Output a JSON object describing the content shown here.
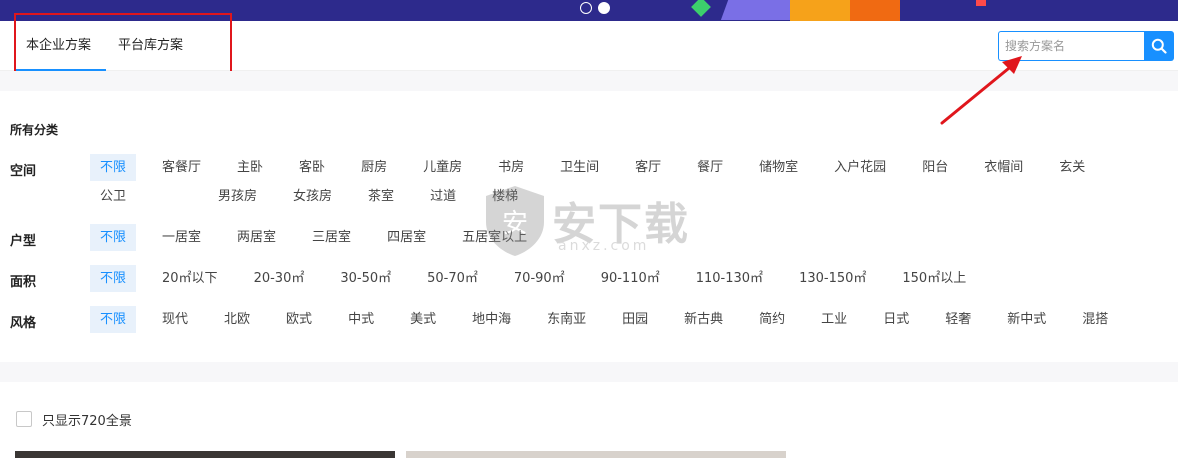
{
  "tabs": [
    {
      "label": "本企业方案",
      "active": true
    },
    {
      "label": "平台库方案",
      "active": false
    }
  ],
  "search": {
    "placeholder": "搜索方案名"
  },
  "filters": {
    "all_label": "所有分类",
    "rows": [
      {
        "label": "空间",
        "options": [
          "不限",
          "客餐厅",
          "主卧",
          "客卧",
          "厨房",
          "儿童房",
          "书房",
          "卫生间",
          "客厅",
          "餐厅",
          "储物室",
          "入户花园",
          "阳台",
          "衣帽间",
          "玄关",
          "公卫",
          "男孩房",
          "女孩房",
          "茶室",
          "过道",
          "楼梯"
        ]
      },
      {
        "label": "户型",
        "options": [
          "不限",
          "一居室",
          "两居室",
          "三居室",
          "四居室",
          "五居室以上"
        ]
      },
      {
        "label": "面积",
        "options": [
          "不限",
          "20㎡以下",
          "20-30㎡",
          "30-50㎡",
          "50-70㎡",
          "70-90㎡",
          "90-110㎡",
          "110-130㎡",
          "130-150㎡",
          "150㎡以上"
        ]
      },
      {
        "label": "风格",
        "options": [
          "不限",
          "现代",
          "北欧",
          "欧式",
          "中式",
          "美式",
          "地中海",
          "东南亚",
          "田园",
          "新古典",
          "简约",
          "工业",
          "日式",
          "轻奢",
          "新中式",
          "混搭"
        ]
      }
    ]
  },
  "panorama": {
    "label": "只显示720全景",
    "checked": false
  },
  "watermark": {
    "text": "安下载",
    "sub": "anxz.com"
  },
  "colors": {
    "accent": "#1890ff",
    "annotation": "#e0161c",
    "banner": "#2d2a8c"
  }
}
